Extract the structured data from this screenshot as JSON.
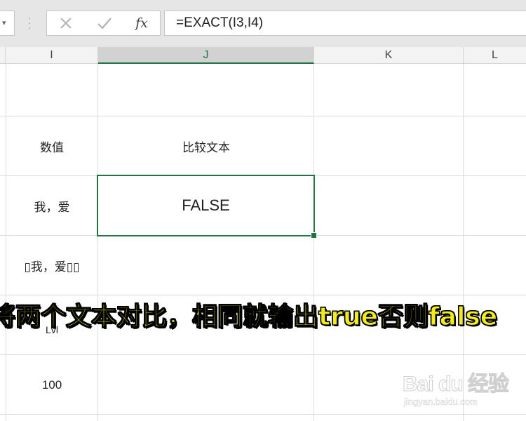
{
  "formula_bar": {
    "cancel_icon": "close-icon",
    "enter_icon": "check-icon",
    "fx_label": "fx",
    "formula": "=EXACT(I3,I4)"
  },
  "columns": [
    {
      "label": "I",
      "selected": false
    },
    {
      "label": "J",
      "selected": true
    },
    {
      "label": "K",
      "selected": false
    },
    {
      "label": "L",
      "selected": false
    }
  ],
  "cells": {
    "i2": "数值",
    "j2": "比较文本",
    "i3": "我，爱",
    "j3": "FALSE",
    "i4": "\u0000我，爱\u0000\u0000",
    "i4_display": "▯我，爱▯▯",
    "i5": "Lvl",
    "i6": "100"
  },
  "caption": "将两个文本对比，相同就输出true否则false",
  "watermark": {
    "main": "Bai du 经验",
    "sub": "jingyan.baidu.com"
  },
  "colors": {
    "accent": "#217346",
    "caption": "#f2ec1c",
    "header_bg": "#f3f3f3",
    "selected_header_bg": "#d2d2d2"
  }
}
